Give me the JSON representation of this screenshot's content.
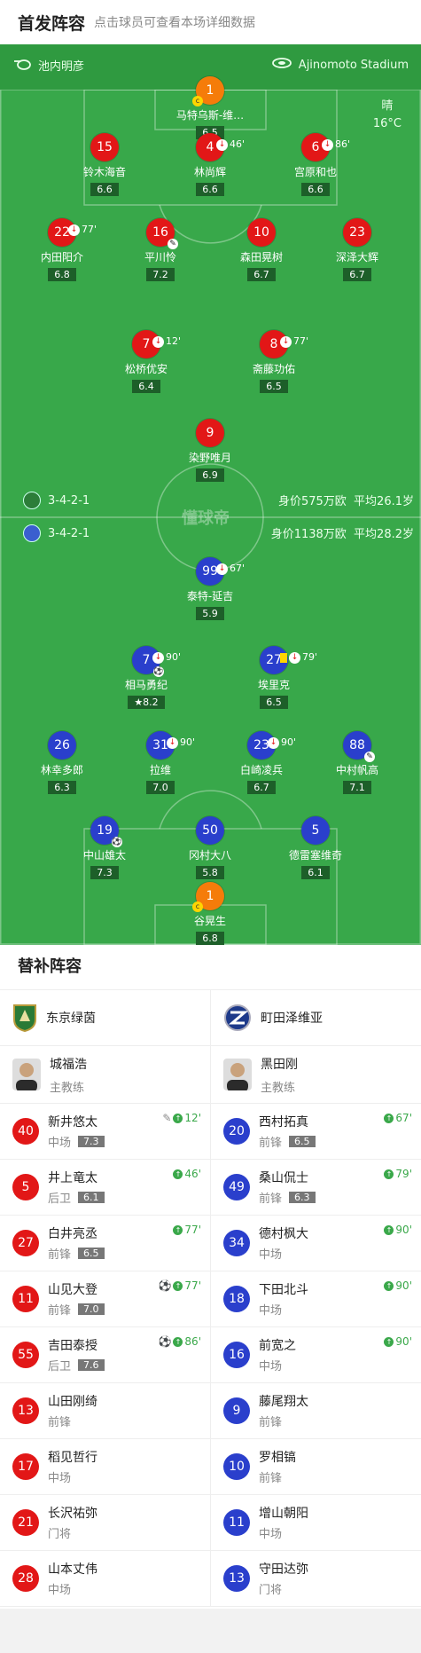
{
  "header": {
    "title": "首发阵容",
    "subtitle": "点击球员可查看本场详细数据"
  },
  "pitch": {
    "home_coach": "池内明彦",
    "venue": "Ajinomoto Stadium",
    "weather": "晴",
    "temperature": "16°C",
    "watermark": "懂球帝",
    "home_formation": "3-4-2-1",
    "home_value": "身价575万欧",
    "home_age": "平均26.1岁",
    "away_formation": "3-4-2-1",
    "away_value": "身价1138万欧",
    "away_age": "平均28.2岁"
  },
  "home_players": [
    {
      "num": "1",
      "name": "马特乌斯-维…",
      "rating": "6.5",
      "gk": true,
      "captain": true
    },
    {
      "num": "15",
      "name": "铃木海音",
      "rating": "6.6"
    },
    {
      "num": "4",
      "name": "林尚辉",
      "rating": "6.6",
      "sub": "46'"
    },
    {
      "num": "6",
      "name": "宫原和也",
      "rating": "6.6",
      "sub": "86'"
    },
    {
      "num": "22",
      "name": "内田阳介",
      "rating": "6.8",
      "sub": "77'"
    },
    {
      "num": "16",
      "name": "平川怜",
      "rating": "7.2",
      "assist": true
    },
    {
      "num": "10",
      "name": "森田晃树",
      "rating": "6.7"
    },
    {
      "num": "23",
      "name": "深泽大辉",
      "rating": "6.7"
    },
    {
      "num": "7",
      "name": "松桥优安",
      "rating": "6.4",
      "sub": "12'"
    },
    {
      "num": "8",
      "name": "斋藤功佑",
      "rating": "6.5",
      "sub": "77'"
    },
    {
      "num": "9",
      "name": "染野唯月",
      "rating": "6.9"
    }
  ],
  "away_players": [
    {
      "num": "99",
      "name": "泰特-延吉",
      "rating": "5.9",
      "sub": "67'"
    },
    {
      "num": "7",
      "name": "相马勇纪",
      "rating": "8.2",
      "sub": "90'",
      "goal": true,
      "star": true
    },
    {
      "num": "27",
      "name": "埃里克",
      "rating": "6.5",
      "sub": "79'",
      "yellow": true
    },
    {
      "num": "26",
      "name": "林幸多郎",
      "rating": "6.3"
    },
    {
      "num": "31",
      "name": "拉维",
      "rating": "7.0",
      "sub": "90'"
    },
    {
      "num": "23",
      "name": "白崎凌兵",
      "rating": "6.7",
      "sub": "90'"
    },
    {
      "num": "88",
      "name": "中村帆高",
      "rating": "7.1",
      "assist": true
    },
    {
      "num": "19",
      "name": "中山雄太",
      "rating": "7.3",
      "goal": true
    },
    {
      "num": "50",
      "name": "冈村大八",
      "rating": "5.8"
    },
    {
      "num": "5",
      "name": "德雷塞维奇",
      "rating": "6.1"
    },
    {
      "num": "1",
      "name": "谷晃生",
      "rating": "6.8",
      "gk": true,
      "captain": true
    }
  ],
  "subs": {
    "title": "替补阵容",
    "home": {
      "team": "东京绿茵",
      "coach": "城福浩",
      "coach_role": "主教练",
      "players": [
        {
          "num": "40",
          "name": "新井悠太",
          "pos": "中场",
          "rating": "7.3",
          "ev": "12'",
          "assist": true
        },
        {
          "num": "5",
          "name": "井上竜太",
          "pos": "后卫",
          "rating": "6.1",
          "ev": "46'"
        },
        {
          "num": "27",
          "name": "白井亮丞",
          "pos": "前锋",
          "rating": "6.5",
          "ev": "77'"
        },
        {
          "num": "11",
          "name": "山见大登",
          "pos": "前锋",
          "rating": "7.0",
          "ev": "77'",
          "goal": true
        },
        {
          "num": "55",
          "name": "吉田泰授",
          "pos": "后卫",
          "rating": "7.6",
          "ev": "86'",
          "goal": true
        },
        {
          "num": "13",
          "name": "山田刚绮",
          "pos": "前锋"
        },
        {
          "num": "17",
          "name": "稻见哲行",
          "pos": "中场"
        },
        {
          "num": "21",
          "name": "长沢祐弥",
          "pos": "门将"
        },
        {
          "num": "28",
          "name": "山本丈伟",
          "pos": "中场"
        }
      ]
    },
    "away": {
      "team": "町田泽维亚",
      "coach": "黑田刚",
      "coach_role": "主教练",
      "players": [
        {
          "num": "20",
          "name": "西村拓真",
          "pos": "前锋",
          "rating": "6.5",
          "ev": "67'"
        },
        {
          "num": "49",
          "name": "桑山侃士",
          "pos": "前锋",
          "rating": "6.3",
          "ev": "79'"
        },
        {
          "num": "34",
          "name": "德村枫大",
          "pos": "中场",
          "ev": "90'"
        },
        {
          "num": "18",
          "name": "下田北斗",
          "pos": "中场",
          "ev": "90'"
        },
        {
          "num": "16",
          "name": "前宽之",
          "pos": "中场",
          "ev": "90'"
        },
        {
          "num": "9",
          "name": "藤尾翔太",
          "pos": "前锋"
        },
        {
          "num": "10",
          "name": "罗相镐",
          "pos": "前锋"
        },
        {
          "num": "11",
          "name": "增山朝阳",
          "pos": "中场"
        },
        {
          "num": "13",
          "name": "守田达弥",
          "pos": "门将"
        }
      ]
    }
  },
  "icons": {
    "sub_out": "sub-out-icon",
    "sub_in": "sub-in-icon",
    "goal": "ball-icon",
    "assist": "boot-icon",
    "captain": "captain-icon"
  },
  "colors": {
    "home": "#e21717",
    "away": "#2a3fcc",
    "gk": "#f57c0a",
    "pitch": "#38a84a"
  }
}
